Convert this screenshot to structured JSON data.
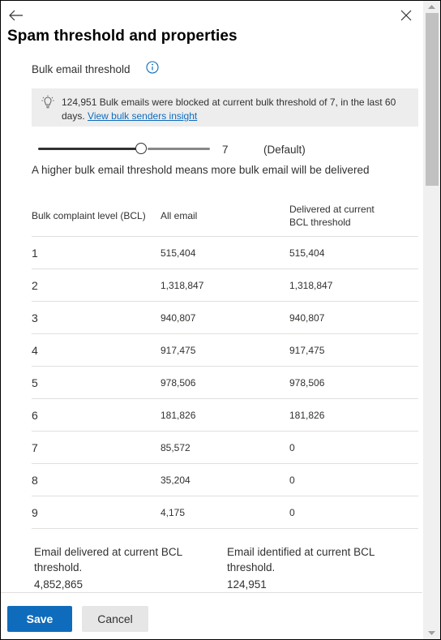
{
  "panel": {
    "title": "Spam threshold and properties",
    "back_icon": "arrow-left-icon",
    "close_icon": "close-icon"
  },
  "bulk": {
    "section_label": "Bulk email threshold",
    "info_icon": "info-icon",
    "banner": {
      "icon": "lightbulb-icon",
      "text": "124,951 Bulk emails were blocked at current bulk threshold of 7, in the last 60 days.",
      "link": "View bulk senders insight"
    },
    "slider": {
      "value": 7,
      "min": 1,
      "max": 9,
      "value_label": "7",
      "default_label": "(Default)"
    },
    "hint": "A higher bulk email threshold means more bulk email will be delivered"
  },
  "table": {
    "headers": [
      "Bulk complaint level (BCL)",
      "All email",
      "Delivered at current BCL threshold"
    ],
    "rows": [
      [
        "1",
        "515,404",
        "515,404"
      ],
      [
        "2",
        "1,318,847",
        "1,318,847"
      ],
      [
        "3",
        "940,807",
        "940,807"
      ],
      [
        "4",
        "917,475",
        "917,475"
      ],
      [
        "5",
        "978,506",
        "978,506"
      ],
      [
        "6",
        "181,826",
        "181,826"
      ],
      [
        "7",
        "85,572",
        "0"
      ],
      [
        "8",
        "35,204",
        "0"
      ],
      [
        "9",
        "4,175",
        "0"
      ]
    ]
  },
  "summary": {
    "delivered_label": "Email delivered at current BCL threshold.",
    "delivered_value": "4,852,865",
    "identified_label": "Email identified at current BCL threshold.",
    "identified_value": "124,951"
  },
  "footer": {
    "save_label": "Save",
    "cancel_label": "Cancel"
  },
  "colors": {
    "accent": "#0f6cbd",
    "banner_bg": "#ededed",
    "divider": "#e1dfdd"
  }
}
